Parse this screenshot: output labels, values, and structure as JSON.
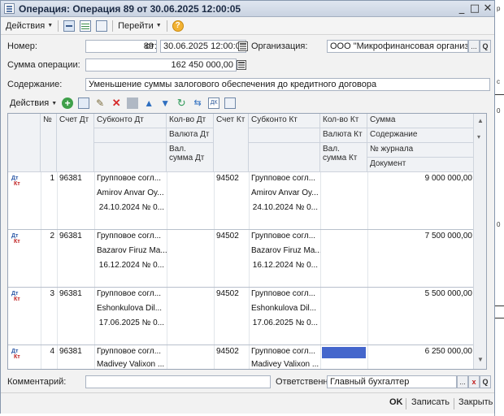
{
  "window": {
    "title": "Операция: Операция 89 от 30.06.2025 12:00:05",
    "controls": [
      "_",
      "□",
      "✕"
    ]
  },
  "toolbar": {
    "actions_label": "Действия",
    "goto_label": "Перейти",
    "help_glyph": "?"
  },
  "form": {
    "number_label": "Номер:",
    "number_value": "89",
    "date_label": "от:",
    "date_value": "30.06.2025 12:00:05",
    "org_label": "Организация:",
    "org_value": "ООО \"Микрофинансовая организац",
    "amount_label": "Сумма операции:",
    "amount_value": "162 450 000,00",
    "content_label": "Содержание:",
    "content_value": "Уменьшение суммы залогового обеспечения  до кредитного договора",
    "comment_label": "Комментарий:",
    "comment_value": "",
    "responsible_label": "Ответственный:",
    "responsible_value": "Главный бухгалтер",
    "ellipsis": "...",
    "search_glyph": "Q",
    "clear_glyph": "x"
  },
  "grid_toolbar": {
    "actions_label": "Действия"
  },
  "grid": {
    "headers": {
      "num": "№",
      "acc_dt": "Счет Дт",
      "sub_dt": "Субконто Дт",
      "qty_dt": "Кол-во Дт",
      "cur_dt": "Валюта Дт",
      "cur_sum_dt": "Вал. сумма Дт",
      "acc_kt": "Счет Кт",
      "sub_kt": "Субконто Кт",
      "qty_kt": "Кол-во Кт",
      "cur_kt": "Валюта Кт",
      "cur_sum_kt": "Вал. сумма Кт",
      "amount": "Сумма",
      "content": "Содержание",
      "journal": "№ журнала",
      "document": "Документ"
    },
    "dt_mark": "Дт",
    "kt_mark": "Кт",
    "rows": [
      {
        "num": "1",
        "acc_dt": "96381",
        "sub1": "Групповое согл...",
        "sub2": "Amirov Anvar Oy...",
        "sub3": "24.10.2024 № 0...",
        "acc_kt": "94502",
        "ksub1": "Групповое согл...",
        "ksub2": "Amirov Anvar Oy...",
        "ksub3": "24.10.2024 № 0...",
        "amount": "9 000 000,00"
      },
      {
        "num": "2",
        "acc_dt": "96381",
        "sub1": "Групповое согл...",
        "sub2": "Bazarov Firuz Ma...",
        "sub3": "16.12.2024 № 0...",
        "acc_kt": "94502",
        "ksub1": "Групповое согл...",
        "ksub2": "Bazarov Firuz Ma...",
        "ksub3": "16.12.2024 № 0...",
        "amount": "7 500 000,00"
      },
      {
        "num": "3",
        "acc_dt": "96381",
        "sub1": "Групповое согл...",
        "sub2": "Eshonkulova Dil...",
        "sub3": "17.06.2025 № 0...",
        "acc_kt": "94502",
        "ksub1": "Групповое согл...",
        "ksub2": "Eshonkulova Dil...",
        "ksub3": "17.06.2025 № 0...",
        "amount": "5 500 000,00"
      },
      {
        "num": "4",
        "acc_dt": "96381",
        "sub1": "Групповое согл...",
        "sub2": "Madivey Valixon ...",
        "sub3": "",
        "acc_kt": "94502",
        "ksub1": "Групповое согл...",
        "ksub2": "Madivey Valixon ...",
        "ksub3": "",
        "amount": "6 250 000,00"
      }
    ]
  },
  "bottom": {
    "ok": "OK",
    "save": "Записать",
    "close": "Закрыть"
  },
  "background_window": {
    "fragments": [
      "р",
      "с",
      "0",
      "0"
    ]
  },
  "colors": {
    "selection": "#4466cc",
    "dt": "#2e5aa8",
    "kt": "#c02020"
  }
}
